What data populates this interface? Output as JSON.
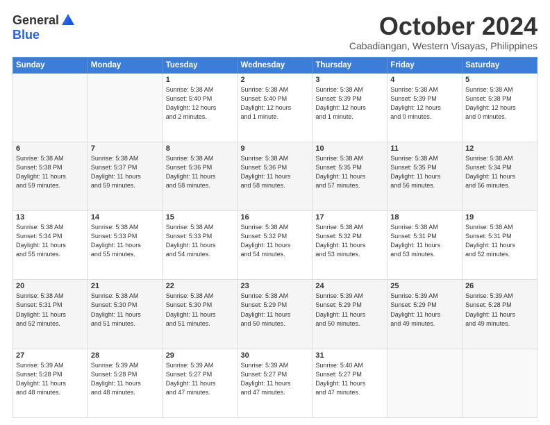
{
  "header": {
    "logo_general": "General",
    "logo_blue": "Blue",
    "month_title": "October 2024",
    "location": "Cabadiangan, Western Visayas, Philippines"
  },
  "weekdays": [
    "Sunday",
    "Monday",
    "Tuesday",
    "Wednesday",
    "Thursday",
    "Friday",
    "Saturday"
  ],
  "weeks": [
    [
      {
        "day": "",
        "info": ""
      },
      {
        "day": "",
        "info": ""
      },
      {
        "day": "1",
        "info": "Sunrise: 5:38 AM\nSunset: 5:40 PM\nDaylight: 12 hours\nand 2 minutes."
      },
      {
        "day": "2",
        "info": "Sunrise: 5:38 AM\nSunset: 5:40 PM\nDaylight: 12 hours\nand 1 minute."
      },
      {
        "day": "3",
        "info": "Sunrise: 5:38 AM\nSunset: 5:39 PM\nDaylight: 12 hours\nand 1 minute."
      },
      {
        "day": "4",
        "info": "Sunrise: 5:38 AM\nSunset: 5:39 PM\nDaylight: 12 hours\nand 0 minutes."
      },
      {
        "day": "5",
        "info": "Sunrise: 5:38 AM\nSunset: 5:38 PM\nDaylight: 12 hours\nand 0 minutes."
      }
    ],
    [
      {
        "day": "6",
        "info": "Sunrise: 5:38 AM\nSunset: 5:38 PM\nDaylight: 11 hours\nand 59 minutes."
      },
      {
        "day": "7",
        "info": "Sunrise: 5:38 AM\nSunset: 5:37 PM\nDaylight: 11 hours\nand 59 minutes."
      },
      {
        "day": "8",
        "info": "Sunrise: 5:38 AM\nSunset: 5:36 PM\nDaylight: 11 hours\nand 58 minutes."
      },
      {
        "day": "9",
        "info": "Sunrise: 5:38 AM\nSunset: 5:36 PM\nDaylight: 11 hours\nand 58 minutes."
      },
      {
        "day": "10",
        "info": "Sunrise: 5:38 AM\nSunset: 5:35 PM\nDaylight: 11 hours\nand 57 minutes."
      },
      {
        "day": "11",
        "info": "Sunrise: 5:38 AM\nSunset: 5:35 PM\nDaylight: 11 hours\nand 56 minutes."
      },
      {
        "day": "12",
        "info": "Sunrise: 5:38 AM\nSunset: 5:34 PM\nDaylight: 11 hours\nand 56 minutes."
      }
    ],
    [
      {
        "day": "13",
        "info": "Sunrise: 5:38 AM\nSunset: 5:34 PM\nDaylight: 11 hours\nand 55 minutes."
      },
      {
        "day": "14",
        "info": "Sunrise: 5:38 AM\nSunset: 5:33 PM\nDaylight: 11 hours\nand 55 minutes."
      },
      {
        "day": "15",
        "info": "Sunrise: 5:38 AM\nSunset: 5:33 PM\nDaylight: 11 hours\nand 54 minutes."
      },
      {
        "day": "16",
        "info": "Sunrise: 5:38 AM\nSunset: 5:32 PM\nDaylight: 11 hours\nand 54 minutes."
      },
      {
        "day": "17",
        "info": "Sunrise: 5:38 AM\nSunset: 5:32 PM\nDaylight: 11 hours\nand 53 minutes."
      },
      {
        "day": "18",
        "info": "Sunrise: 5:38 AM\nSunset: 5:31 PM\nDaylight: 11 hours\nand 53 minutes."
      },
      {
        "day": "19",
        "info": "Sunrise: 5:38 AM\nSunset: 5:31 PM\nDaylight: 11 hours\nand 52 minutes."
      }
    ],
    [
      {
        "day": "20",
        "info": "Sunrise: 5:38 AM\nSunset: 5:31 PM\nDaylight: 11 hours\nand 52 minutes."
      },
      {
        "day": "21",
        "info": "Sunrise: 5:38 AM\nSunset: 5:30 PM\nDaylight: 11 hours\nand 51 minutes."
      },
      {
        "day": "22",
        "info": "Sunrise: 5:38 AM\nSunset: 5:30 PM\nDaylight: 11 hours\nand 51 minutes."
      },
      {
        "day": "23",
        "info": "Sunrise: 5:38 AM\nSunset: 5:29 PM\nDaylight: 11 hours\nand 50 minutes."
      },
      {
        "day": "24",
        "info": "Sunrise: 5:39 AM\nSunset: 5:29 PM\nDaylight: 11 hours\nand 50 minutes."
      },
      {
        "day": "25",
        "info": "Sunrise: 5:39 AM\nSunset: 5:29 PM\nDaylight: 11 hours\nand 49 minutes."
      },
      {
        "day": "26",
        "info": "Sunrise: 5:39 AM\nSunset: 5:28 PM\nDaylight: 11 hours\nand 49 minutes."
      }
    ],
    [
      {
        "day": "27",
        "info": "Sunrise: 5:39 AM\nSunset: 5:28 PM\nDaylight: 11 hours\nand 48 minutes."
      },
      {
        "day": "28",
        "info": "Sunrise: 5:39 AM\nSunset: 5:28 PM\nDaylight: 11 hours\nand 48 minutes."
      },
      {
        "day": "29",
        "info": "Sunrise: 5:39 AM\nSunset: 5:27 PM\nDaylight: 11 hours\nand 47 minutes."
      },
      {
        "day": "30",
        "info": "Sunrise: 5:39 AM\nSunset: 5:27 PM\nDaylight: 11 hours\nand 47 minutes."
      },
      {
        "day": "31",
        "info": "Sunrise: 5:40 AM\nSunset: 5:27 PM\nDaylight: 11 hours\nand 47 minutes."
      },
      {
        "day": "",
        "info": ""
      },
      {
        "day": "",
        "info": ""
      }
    ]
  ]
}
